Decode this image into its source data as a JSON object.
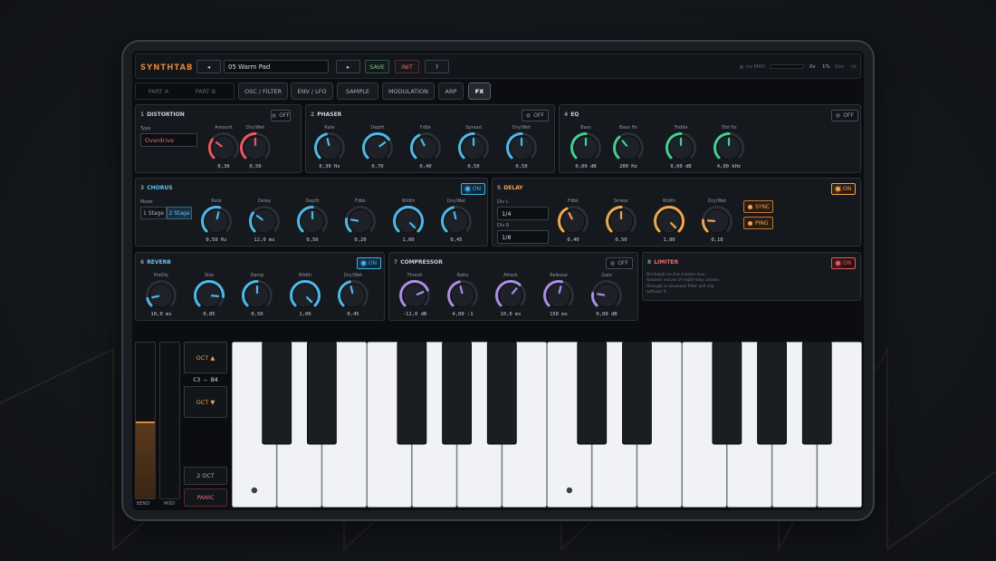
{
  "colors": {
    "accent_orange": "#e0843a",
    "knob_blue": "#4db8e8",
    "knob_red": "#ee5561",
    "knob_green": "#3fcf8e",
    "knob_purple": "#a98ee6",
    "knob_orange": "#f0a550",
    "on_blue": "#3fb2e8",
    "on_red": "#e65a5a"
  },
  "topbar": {
    "brand": "SYNTHTAB",
    "prev": "◂",
    "preset": "05 Warm Pad",
    "next": "▸",
    "save": "SAVE",
    "init": "INIT",
    "help": "?",
    "midi": "no MIDI",
    "voices": "0v",
    "cpu": "1%",
    "dots": "0os",
    "clock": "ck"
  },
  "tabs": {
    "part_a": "PART A",
    "part_b": "PART B",
    "items": [
      {
        "label": "OSC / FILTER",
        "active": false
      },
      {
        "label": "ENV / LFO",
        "active": false
      },
      {
        "label": "SAMPLE",
        "active": false
      },
      {
        "label": "MODULATION",
        "active": false
      },
      {
        "label": "ARP",
        "active": false
      },
      {
        "label": "FX",
        "active": true
      }
    ]
  },
  "fx": {
    "distortion": {
      "num": "1",
      "title": "DISTORTION",
      "state": "OFF",
      "on": false,
      "type_label": "Type",
      "type_value": "Overdrive",
      "knobs": [
        {
          "label": "Amount",
          "value": "0,30",
          "level": 0.3,
          "color": "knob_red"
        },
        {
          "label": "Dry/Wet",
          "value": "0,50",
          "level": 0.5,
          "color": "knob_red"
        }
      ]
    },
    "phaser": {
      "num": "2",
      "title": "PHASER",
      "state": "OFF",
      "on": false,
      "knobs": [
        {
          "label": "Rate",
          "value": "0,30 Hz",
          "level": 0.45,
          "color": "knob_blue"
        },
        {
          "label": "Depth",
          "value": "0,70",
          "level": 0.7,
          "color": "knob_blue"
        },
        {
          "label": "Fdbk",
          "value": "0,40",
          "level": 0.4,
          "color": "knob_blue"
        },
        {
          "label": "Spread",
          "value": "0,50",
          "level": 0.5,
          "color": "knob_blue"
        },
        {
          "label": "Dry/Wet",
          "value": "0,50",
          "level": 0.5,
          "color": "knob_blue"
        }
      ]
    },
    "eq": {
      "num": "4",
      "title": "EQ",
      "state": "OFF",
      "on": false,
      "knobs": [
        {
          "label": "Bass",
          "value": "0,00 dB",
          "level": 0.5,
          "color": "knob_green"
        },
        {
          "label": "Bass Hz",
          "value": "200 Hz",
          "level": 0.35,
          "color": "knob_green"
        },
        {
          "label": "Treble",
          "value": "0,00 dB",
          "level": 0.5,
          "color": "knob_green"
        },
        {
          "label": "Trbl Hz",
          "value": "4,00 kHz",
          "level": 0.5,
          "color": "knob_green"
        }
      ]
    },
    "chorus": {
      "num": "3",
      "title": "CHORUS",
      "state": "ON",
      "on": true,
      "mode_label": "Mode",
      "mode_a": "1 Stage",
      "mode_b": "2 Stage",
      "knobs": [
        {
          "label": "Rate",
          "value": "0,50 Hz",
          "level": 0.55,
          "color": "knob_blue"
        },
        {
          "label": "Delay",
          "value": "12,0 ms",
          "level": 0.3,
          "color": "knob_blue"
        },
        {
          "label": "Depth",
          "value": "0,50",
          "level": 0.5,
          "color": "knob_blue"
        },
        {
          "label": "Fdbk",
          "value": "0,20",
          "level": 0.2,
          "color": "knob_blue"
        },
        {
          "label": "Width",
          "value": "1,00",
          "level": 1.0,
          "color": "knob_blue"
        },
        {
          "label": "Dry/Wet",
          "value": "0,45",
          "level": 0.45,
          "color": "knob_blue"
        }
      ]
    },
    "delay": {
      "num": "5",
      "title": "DELAY",
      "state": "ON",
      "on": true,
      "div_l_label": "Div L",
      "div_l": "1/4",
      "div_r_label": "Div R",
      "div_r": "1/8",
      "sync": "SYNC",
      "ping": "PING",
      "knobs": [
        {
          "label": "Fdbk",
          "value": "0,40",
          "level": 0.4,
          "color": "knob_orange"
        },
        {
          "label": "Smear",
          "value": "0,50",
          "level": 0.5,
          "color": "knob_orange"
        },
        {
          "label": "Width",
          "value": "1,00",
          "level": 1.0,
          "color": "knob_orange"
        },
        {
          "label": "Dry/Wet",
          "value": "0,18",
          "level": 0.18,
          "color": "knob_orange"
        }
      ]
    },
    "reverb": {
      "num": "6",
      "title": "REVERB",
      "state": "ON",
      "on": true,
      "knobs": [
        {
          "label": "PreDly",
          "value": "10,0 ms",
          "level": 0.12,
          "color": "knob_blue"
        },
        {
          "label": "Size",
          "value": "0,85",
          "level": 0.85,
          "color": "knob_blue"
        },
        {
          "label": "Damp",
          "value": "0,50",
          "level": 0.5,
          "color": "knob_blue"
        },
        {
          "label": "Width",
          "value": "1,00",
          "level": 1.0,
          "color": "knob_blue"
        },
        {
          "label": "Dry/Wet",
          "value": "0,45",
          "level": 0.45,
          "color": "knob_blue"
        }
      ]
    },
    "compressor": {
      "num": "7",
      "title": "COMPRESSOR",
      "state": "OFF",
      "on": false,
      "knobs": [
        {
          "label": "Thresh",
          "value": "-12,0 dB",
          "level": 0.75,
          "color": "knob_purple"
        },
        {
          "label": "Ratio",
          "value": "4,00 :1",
          "level": 0.45,
          "color": "knob_purple"
        },
        {
          "label": "Attack",
          "value": "10,0 ms",
          "level": 0.65,
          "color": "knob_purple"
        },
        {
          "label": "Release",
          "value": "150 ms",
          "level": 0.55,
          "color": "knob_purple"
        },
        {
          "label": "Gain",
          "value": "0,00 dB",
          "level": 0.2,
          "color": "knob_purple"
        }
      ]
    },
    "limiter": {
      "num": "8",
      "title": "LIMITER",
      "state": "ON",
      "on": true,
      "description": [
        "Brickwall on the master bus.",
        "Sixteen voices of eight-way unison",
        "through a resonant filter will clip",
        "without it."
      ]
    }
  },
  "perform": {
    "bend": "BEND",
    "mod": "MOD",
    "bend_level": 0.5,
    "oct_up": "OCT ▲",
    "range": "C3 – B4",
    "oct_down": "OCT ▼",
    "two_oct": "2 OCT",
    "panic": "PANIC"
  }
}
